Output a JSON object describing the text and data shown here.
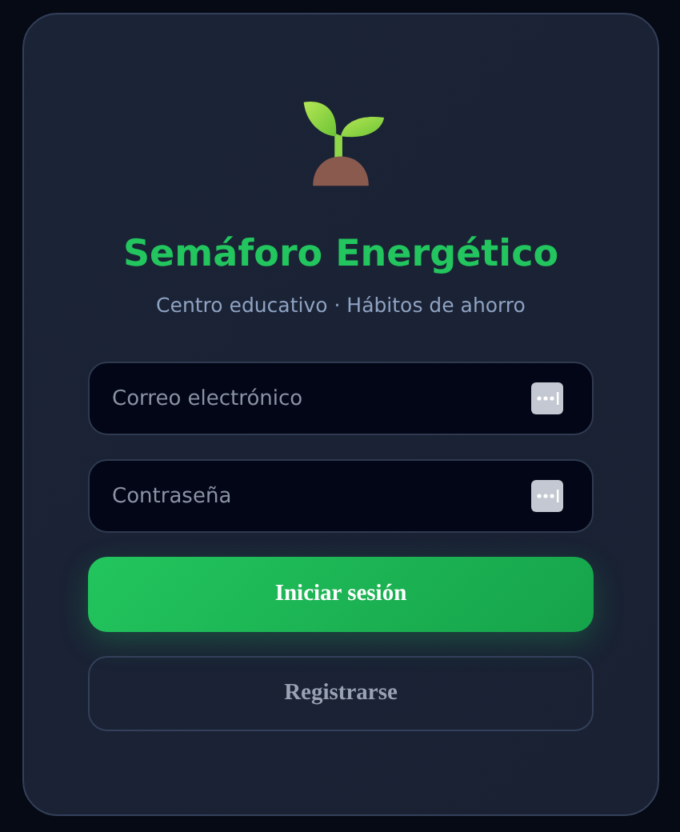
{
  "app": {
    "title": "Semáforo Energético",
    "subtitle": "Centro educativo · Hábitos de ahorro"
  },
  "fields": [
    {
      "placeholder": "Correo electrónico"
    },
    {
      "placeholder": "Contraseña"
    }
  ],
  "buttons": [
    {
      "kind": "primary",
      "label": "Iniciar sesión"
    },
    {
      "kind": "secondary",
      "label": "Registrarse"
    }
  ]
}
